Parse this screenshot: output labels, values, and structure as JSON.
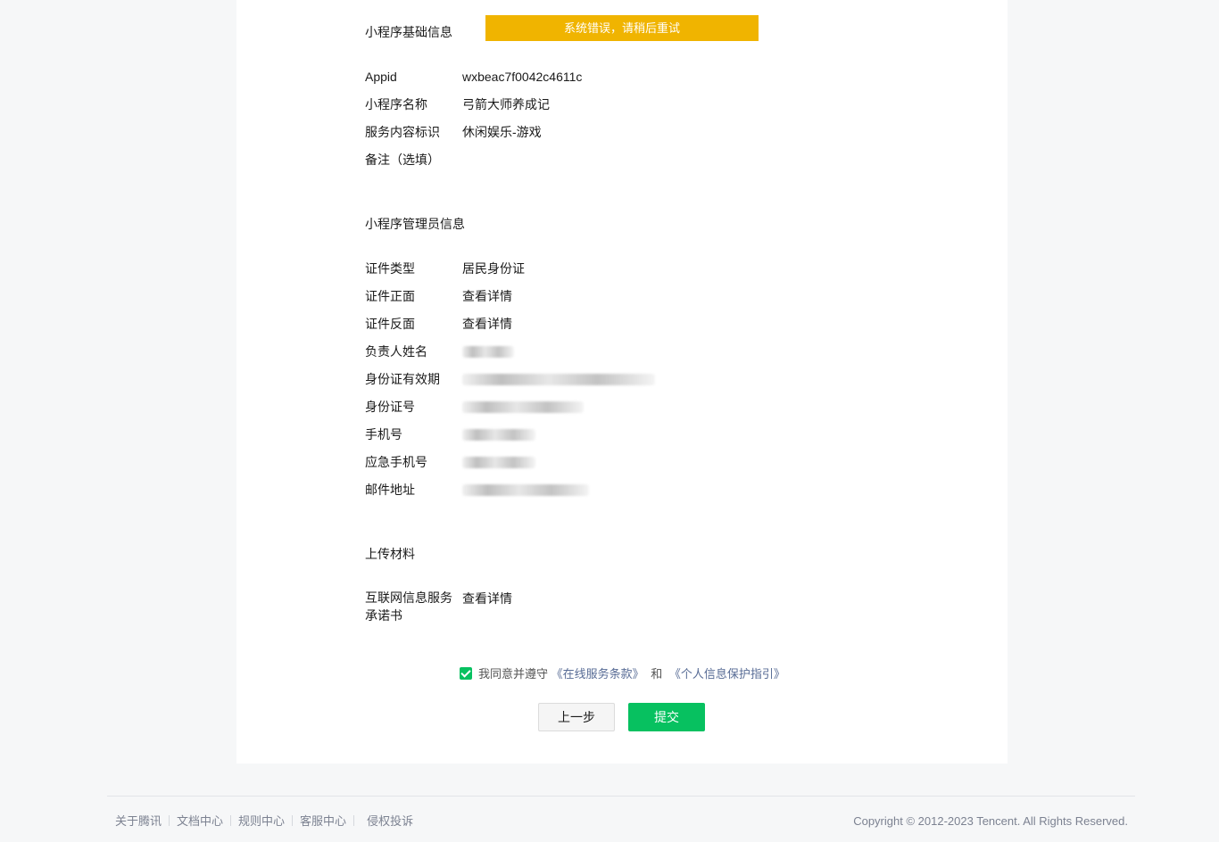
{
  "toast": {
    "text": "系统错误，请稍后重试"
  },
  "basic": {
    "title": "小程序基础信息",
    "rows": [
      {
        "label": "Appid",
        "value": "wxbeac7f0042c4611c"
      },
      {
        "label": "小程序名称",
        "value": "弓箭大师养成记"
      },
      {
        "label": "服务内容标识",
        "value": "休闲娱乐-游戏"
      },
      {
        "label": "备注（选填）",
        "value": ""
      }
    ]
  },
  "admin": {
    "title": "小程序管理员信息",
    "cert_type": {
      "label": "证件类型",
      "value": "居民身份证"
    },
    "cert_front": {
      "label": "证件正面",
      "link": "查看详情"
    },
    "cert_back": {
      "label": "证件反面",
      "link": "查看详情"
    },
    "name": {
      "label": "负责人姓名"
    },
    "id_validity": {
      "label": "身份证有效期"
    },
    "id_number": {
      "label": "身份证号"
    },
    "phone": {
      "label": "手机号"
    },
    "emergency_phone": {
      "label": "应急手机号"
    },
    "email": {
      "label": "邮件地址"
    }
  },
  "upload": {
    "title": "上传材料",
    "commitment": {
      "label": "互联网信息服务承诺书",
      "link": "查看详情"
    }
  },
  "agreement": {
    "checked": true,
    "prefix": "我同意并遵守",
    "terms_link": "《在线服务条款》",
    "and": "和",
    "privacy_link": "《个人信息保护指引》"
  },
  "buttons": {
    "prev": "上一步",
    "submit": "提交"
  },
  "footer": {
    "links": [
      "关于腾讯",
      "文档中心",
      "规则中心",
      "客服中心",
      "侵权投诉"
    ],
    "copyright": "Copyright © 2012-2023 Tencent. All Rights Reserved."
  },
  "colors": {
    "accent": "#07c160",
    "link": "#576b95",
    "toast": "#f0b400",
    "background": "#f6f7f8"
  }
}
